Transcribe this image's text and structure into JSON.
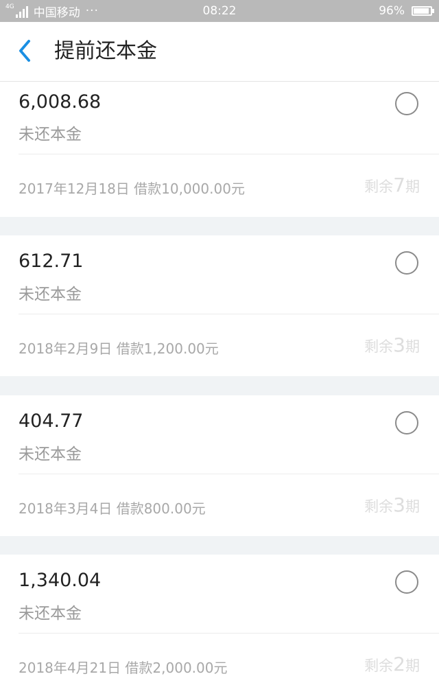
{
  "status_bar": {
    "network": "4G",
    "carrier": "中国移动",
    "more": "···",
    "time": "08:22",
    "battery": "96%"
  },
  "header": {
    "title": "提前还本金",
    "back_icon": "chevron-left-icon",
    "accent_color": "#1a8fe3"
  },
  "loans": [
    {
      "amount": "6,008.68",
      "amount_label": "未还本金",
      "info": "2017年12月18日 借款10,000.00元",
      "remaining_prefix": "剩余",
      "remaining_count": "7",
      "remaining_suffix": "期"
    },
    {
      "amount": "612.71",
      "amount_label": "未还本金",
      "info": "2018年2月9日 借款1,200.00元",
      "remaining_prefix": "剩余",
      "remaining_count": "3",
      "remaining_suffix": "期"
    },
    {
      "amount": "404.77",
      "amount_label": "未还本金",
      "info": "2018年3月4日 借款800.00元",
      "remaining_prefix": "剩余",
      "remaining_count": "3",
      "remaining_suffix": "期"
    },
    {
      "amount": "1,340.04",
      "amount_label": "未还本金",
      "info": "2018年4月21日 借款2,000.00元",
      "remaining_prefix": "剩余",
      "remaining_count": "2",
      "remaining_suffix": "期"
    }
  ]
}
